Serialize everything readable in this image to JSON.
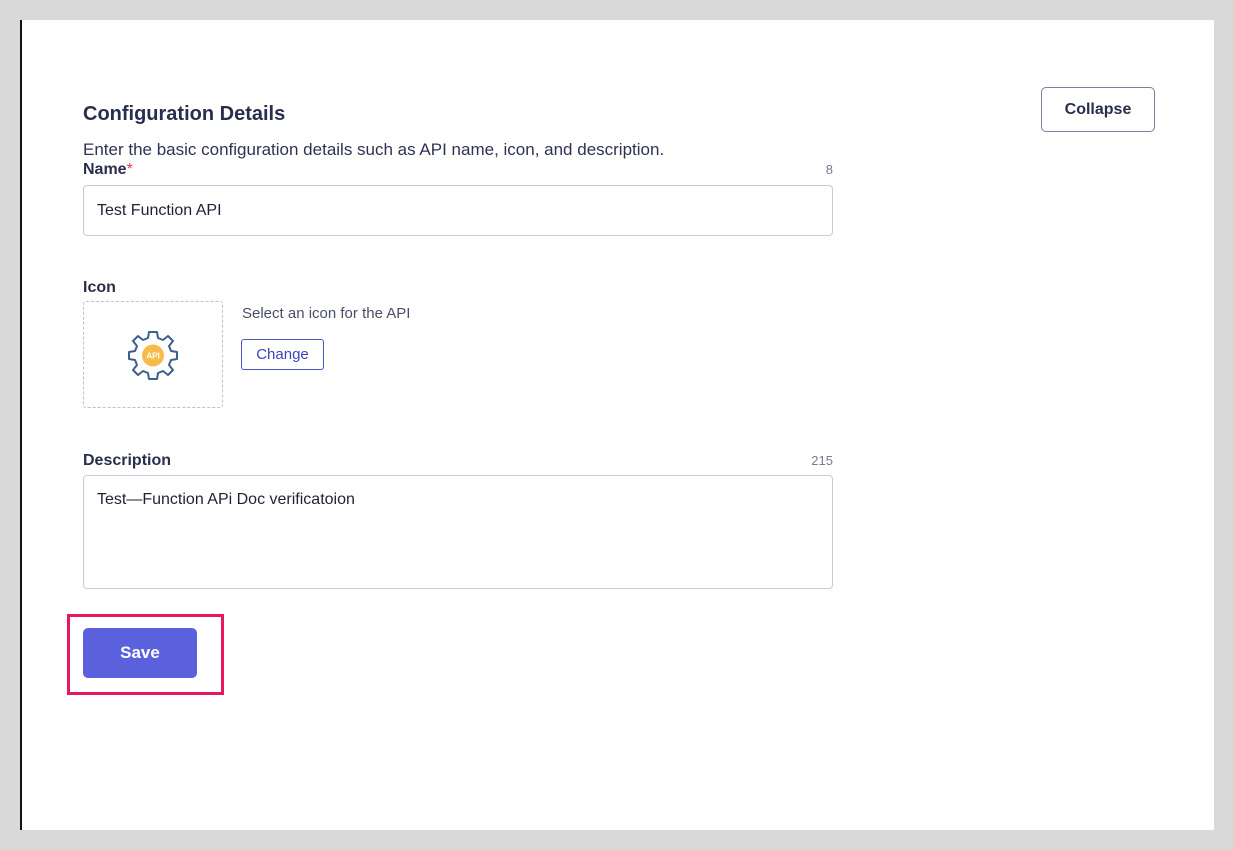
{
  "section": {
    "title": "Configuration Details",
    "subtitle": "Enter the basic configuration details such as API name, icon, and description.",
    "collapse_label": "Collapse"
  },
  "name_field": {
    "label": "Name",
    "required_marker": "*",
    "char_count": "8",
    "value": "Test Function API"
  },
  "icon_field": {
    "label": "Icon",
    "icon": "gear-api-icon",
    "icon_text": "API",
    "hint": "Select an icon for the API",
    "change_label": "Change"
  },
  "description_field": {
    "label": "Description",
    "char_count": "215",
    "value": "Test—Function APi Doc verificatoion"
  },
  "actions": {
    "save_label": "Save"
  },
  "colors": {
    "primary": "#5b60dd",
    "highlight": "#e8185f",
    "required": "#e0354a",
    "icon_accent": "#f7bb4a",
    "icon_outline": "#3d5f8f"
  }
}
